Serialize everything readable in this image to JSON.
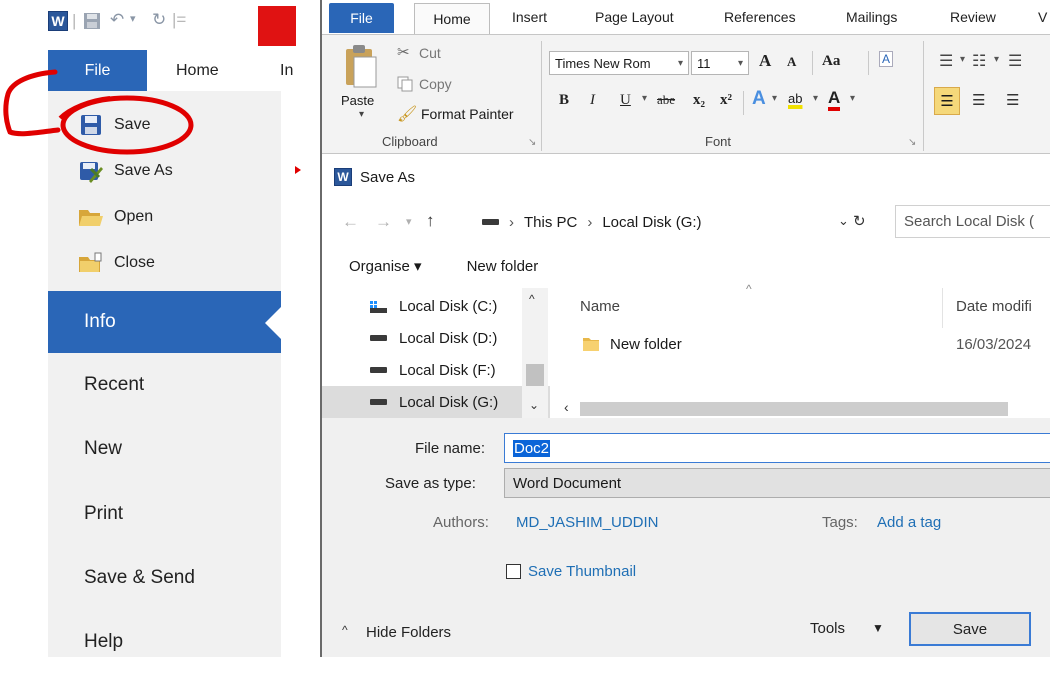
{
  "left_pane": {
    "qat_logo": "W",
    "tabs": [
      "File",
      "Home",
      "In"
    ],
    "menu_items": [
      "Save",
      "Save As",
      "Open",
      "Close"
    ],
    "backstage_items": [
      "Info",
      "Recent",
      "New",
      "Print",
      "Save & Send",
      "Help"
    ],
    "annotation_color": "#e00000"
  },
  "ribbon": {
    "tabs": [
      "File",
      "Home",
      "Insert",
      "Page Layout",
      "References",
      "Mailings",
      "Review",
      "V"
    ],
    "clipboard": {
      "paste": "Paste",
      "cut": "Cut",
      "copy": "Copy",
      "format_painter": "Format Painter",
      "group_label": "Clipboard"
    },
    "font": {
      "font_name": "Times New Rom",
      "font_size": "11",
      "grow": "A",
      "shrink": "A",
      "change_case": "Aa",
      "bold": "B",
      "italic": "I",
      "underline": "U",
      "strike": "abe",
      "sub": "x₂",
      "sup": "x²",
      "group_label": "Font"
    }
  },
  "dialog": {
    "title": "Save As",
    "breadcrumb": [
      "This PC",
      "Local Disk (G:)"
    ],
    "search_placeholder": "Search Local Disk (",
    "organise": "Organise ▾",
    "new_folder": "New folder",
    "nav_items": [
      "Local Disk (C:)",
      "Local Disk (D:)",
      "Local Disk (F:)",
      "Local Disk (G:)"
    ],
    "columns": {
      "name": "Name",
      "date": "Date modifi"
    },
    "files": [
      {
        "name": "New folder",
        "date": "16/03/2024"
      }
    ],
    "file_name_label": "File name:",
    "file_name_value": "Doc2",
    "save_type_label": "Save as type:",
    "save_type_value": "Word Document",
    "authors_label": "Authors:",
    "authors_value": "MD_JASHIM_UDDIN",
    "tags_label": "Tags:",
    "tags_value": "Add a tag",
    "save_thumbnail": "Save Thumbnail",
    "hide_folders": "Hide Folders",
    "tools": "Tools",
    "save_button": "Save",
    "link_color": "#1f6fb5"
  }
}
